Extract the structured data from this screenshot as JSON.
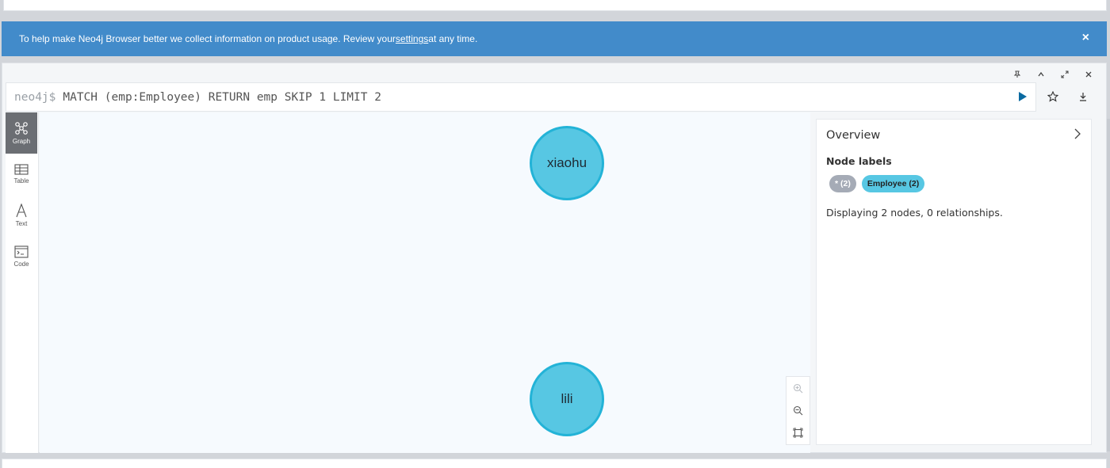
{
  "banner": {
    "text_before": "To help make Neo4j Browser better we collect information on product usage. Review your ",
    "link": "settings",
    "text_after": " at any time.",
    "close": "×"
  },
  "editor": {
    "prompt": "neo4j$",
    "query": "MATCH (emp:Employee) RETURN emp SKIP 1 LIMIT 2"
  },
  "view_tabs": [
    {
      "label": "Graph",
      "icon": "graph-icon",
      "active": true
    },
    {
      "label": "Table",
      "icon": "table-icon",
      "active": false
    },
    {
      "label": "Text",
      "icon": "text-icon",
      "active": false
    },
    {
      "label": "Code",
      "icon": "code-icon",
      "active": false
    }
  ],
  "nodes": [
    {
      "label": "xiaohu",
      "color": "#57c7e3"
    },
    {
      "label": "lili",
      "color": "#57c7e3"
    }
  ],
  "overview": {
    "title": "Overview",
    "node_labels_heading": "Node labels",
    "badges": [
      "* (2)",
      "Employee (2)"
    ],
    "summary": "Displaying 2 nodes, 0 relationships."
  },
  "colors": {
    "banner_bg": "#428bca",
    "node_fill": "#57c7e3",
    "node_border": "#23b3d7",
    "run_button": "#0a6aa1"
  }
}
